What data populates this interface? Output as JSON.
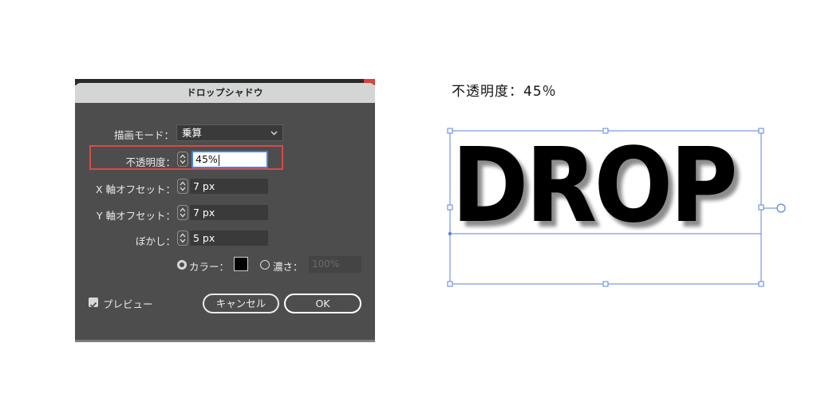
{
  "dialog": {
    "title": "ドロップシャドウ",
    "mode": {
      "label": "描画モード：",
      "value": "乗算"
    },
    "opacity": {
      "label": "不透明度：",
      "value": "45%"
    },
    "x_offset": {
      "label": "X 軸オフセット：",
      "value": "7 px"
    },
    "y_offset": {
      "label": "Y 軸オフセット：",
      "value": "7 px"
    },
    "blur": {
      "label": "ぼかし：",
      "value": "5 px"
    },
    "color_option": {
      "label": "カラー：",
      "selected": true,
      "swatch": "#000000"
    },
    "density_option": {
      "label": "濃さ：",
      "value": "100%",
      "disabled": true
    },
    "preview": {
      "label": "プレビュー",
      "checked": true
    },
    "cancel_label": "キャンセル",
    "ok_label": "OK"
  },
  "canvas": {
    "caption": "不透明度：45％",
    "text": "DROP"
  },
  "colors": {
    "dialog_bg": "#4d4d4d",
    "highlight": "#d94a42",
    "focus": "#3e83f0",
    "selection": "#5b82e0"
  }
}
